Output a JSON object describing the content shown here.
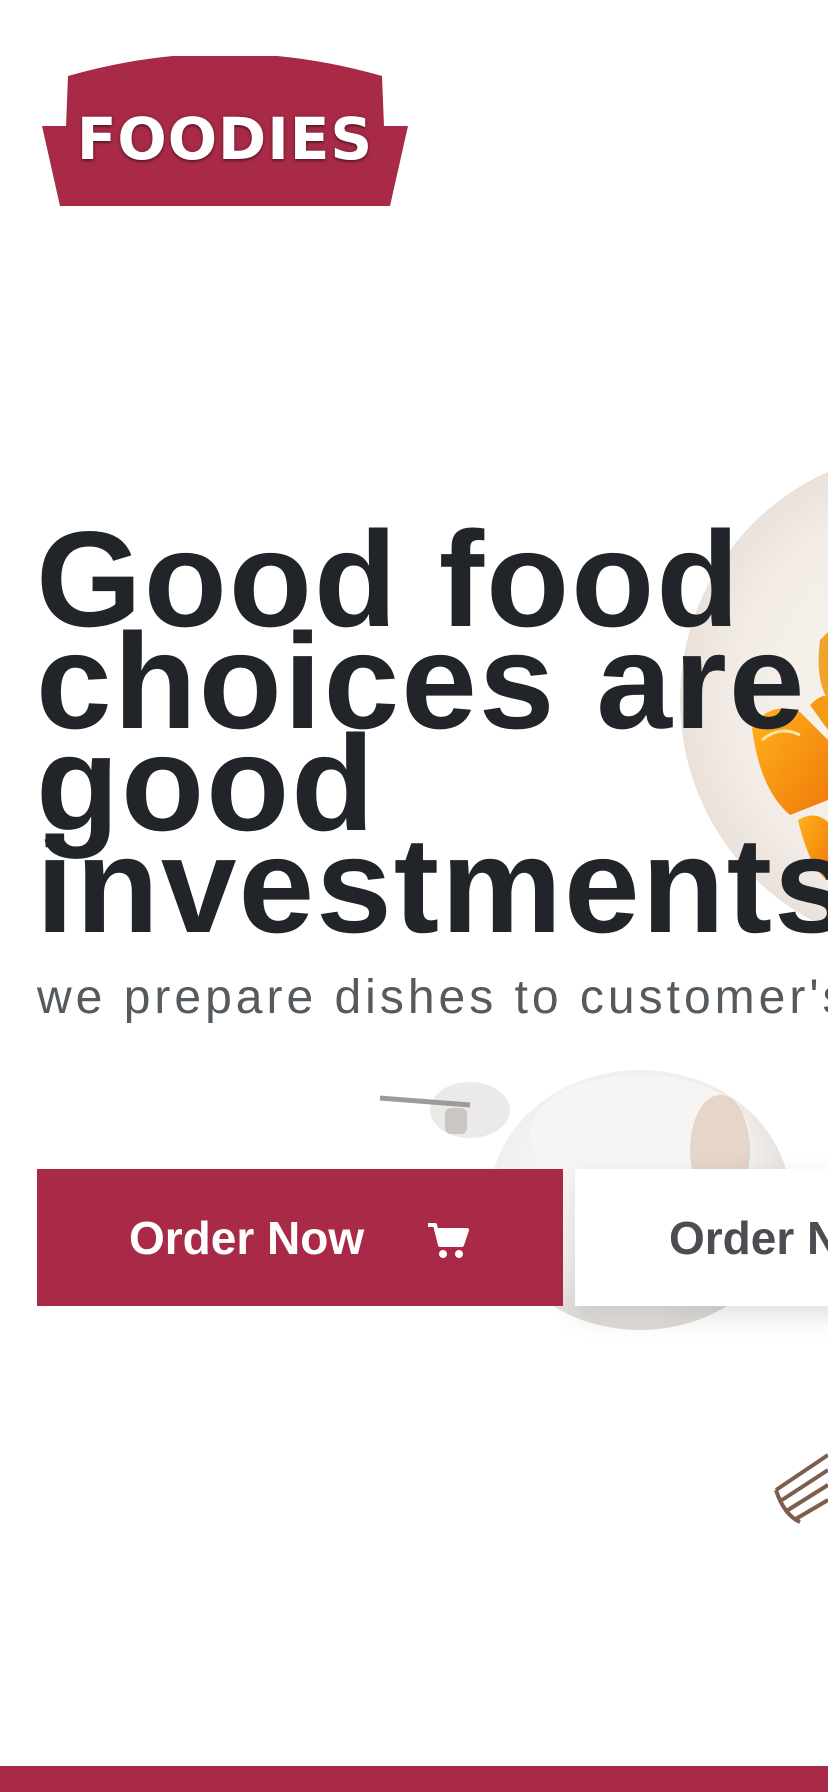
{
  "brand": {
    "logo_text": "FOODIES",
    "primary_color": "#a82a47",
    "logo_color": "#a82a47"
  },
  "hero": {
    "headline": "Good food\nchoices are\ngood\ninvestments",
    "subline": "we prepare dishes to customer's taste",
    "text_color": "#212529"
  },
  "buttons": {
    "primary": {
      "label": "Order Now",
      "icon": "cart-icon"
    },
    "secondary": {
      "label": "Order Now"
    }
  },
  "background": {
    "description_icons": [
      "plate-icon",
      "orange-slices-icon",
      "bowl-icon",
      "fork-icon"
    ]
  }
}
